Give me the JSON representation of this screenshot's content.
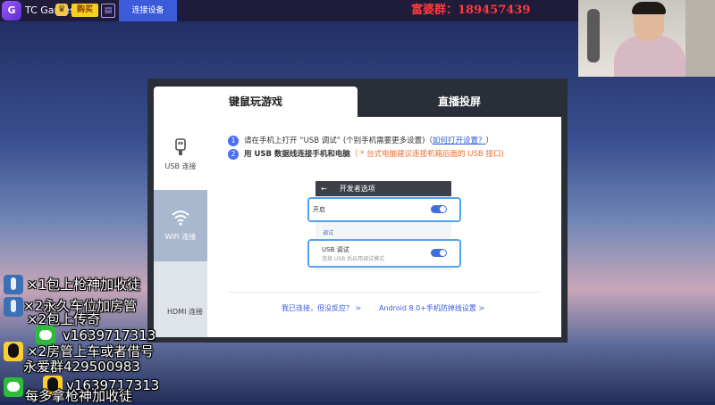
{
  "topbar": {
    "app_name": "TC Games",
    "buy_label": "购买",
    "logo_text": "G",
    "conn_tab": "连接设备",
    "group_no": "富婆群：189457439"
  },
  "dialog": {
    "tab_mouse": "键鼠玩游戏",
    "tab_live": "直播投屏",
    "sidebar": {
      "usb": "USB 连接",
      "wifi": "WiFi 连接",
      "hdmi": "HDMI 连接"
    },
    "step1": {
      "num": "1",
      "text": "请在手机上打开 “USB 调试” (个别手机需要更多设置)（",
      "link": "如何打开设置？",
      "tail": "）"
    },
    "step2": {
      "num": "2",
      "text": "用 USB 数据线连接手机和电脑",
      "note": "（ * 台式电脑建议连接机箱后面的 USB 接口)"
    },
    "phone": {
      "header": "开发者选项",
      "row1": "开启",
      "section": "调试",
      "row2": "USB 调试",
      "row2_sub": "连接 USB 后启用调试模式"
    },
    "footer": {
      "link1": "我已连接，但没反应？ >",
      "link2": "Android 8.0+手机防掉线设置 >"
    }
  },
  "overlay": {
    "line1": "×1包上枪神加收徒",
    "line2": "×2永久车位加房管",
    "line3": "×2包上传奇",
    "line4": "v1639717313",
    "line5": "×2房管上车或者借号",
    "line6": "永爱群429500983",
    "line7": "v1639717313",
    "line8": "每多拿枪神加收徒"
  }
}
